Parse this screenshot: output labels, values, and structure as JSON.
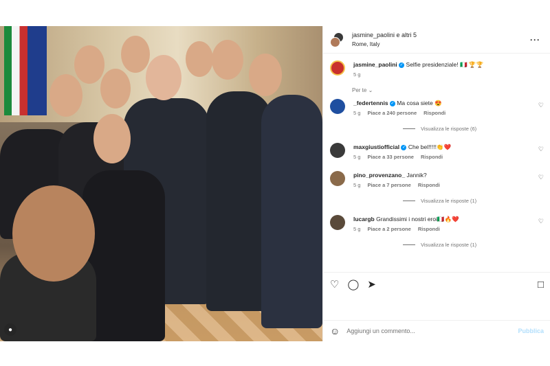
{
  "post": {
    "header_user": "jasmine_paolini e altri 5",
    "location": "Rome, Italy"
  },
  "caption": {
    "username": "jasmine_paolini",
    "text": "Selfie presidenziale! 🇮🇹 🏆🏆",
    "time": "5 g"
  },
  "for_you_label": "Per te",
  "comments": [
    {
      "username": "_federtennis",
      "verified": true,
      "text": "Ma cosa siete 😍",
      "time": "5 g",
      "likes": "Piace a 240 persone",
      "reply": "Rispondi",
      "view_replies": "Visualizza le risposte (6)",
      "avatar_color": "#1f4fa0"
    },
    {
      "username": "maxgiustiofficial",
      "verified": true,
      "text": "Che bel!!!!!👏❤️",
      "time": "5 g",
      "likes": "Piace a 33 persone",
      "reply": "Rispondi",
      "view_replies": "",
      "avatar_color": "#3a3a3a"
    },
    {
      "username": "pino_provenzano_",
      "verified": false,
      "text": "Jannik?",
      "time": "5 g",
      "likes": "Piace a 7 persone",
      "reply": "Rispondi",
      "view_replies": "Visualizza le risposte (1)",
      "avatar_color": "#8a6a4a"
    },
    {
      "username": "lucargb",
      "verified": false,
      "text": "Grandissimi i nostri eroi🇮🇹🔥❤️",
      "time": "5 g",
      "likes": "Piace a 2 persone",
      "reply": "Rispondi",
      "view_replies": "Visualizza le risposte (1)",
      "avatar_color": "#5a4a3a"
    }
  ],
  "composer": {
    "placeholder": "Aggiungi un commento...",
    "publish_label": "Pubblica"
  },
  "icons": {
    "like": "heart-icon",
    "comment": "comment-icon",
    "share": "send-icon",
    "save": "bookmark-icon",
    "emoji": "emoji-icon",
    "more": "more-icon"
  },
  "colors": {
    "verified": "#0095f6",
    "publish_disabled": "#b2dffc",
    "meta_text": "#737373"
  }
}
